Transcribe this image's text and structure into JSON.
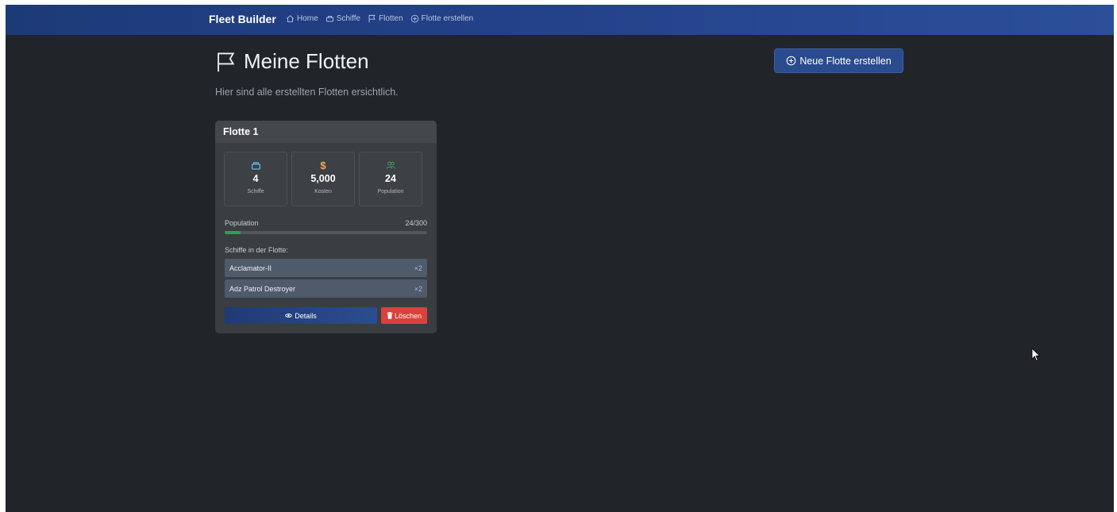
{
  "navbar": {
    "brand": "Fleet Builder",
    "links": [
      {
        "label": "Home",
        "icon": "house-icon"
      },
      {
        "label": "Schiffe",
        "icon": "ship-icon"
      },
      {
        "label": "Flotten",
        "icon": "flag-icon"
      },
      {
        "label": "Flotte erstellen",
        "icon": "plus-circle-icon"
      }
    ]
  },
  "header": {
    "title": "Meine Flotten",
    "subtitle": "Hier sind alle erstellten Flotten ersichtlich.",
    "new_button": "Neue Flotte erstellen"
  },
  "fleet": {
    "name": "Flotte 1",
    "stats": [
      {
        "value": "4",
        "label": "Schiffe",
        "icon": "ship-icon",
        "color": "#5bc0de"
      },
      {
        "value": "5,000",
        "label": "Kosten",
        "icon": "dollar-icon",
        "symbol": "$",
        "color": "#f0ad4e"
      },
      {
        "value": "24",
        "label": "Population",
        "icon": "people-icon",
        "color": "#3fa35f"
      }
    ],
    "population_label": "Population",
    "population_text": "24/300",
    "population_fraction": 0.08,
    "ships_label": "Schiffe in der Flotte:",
    "ships": [
      {
        "name": "Acclamator-II",
        "count": "×2"
      },
      {
        "name": "Adz Patrol Destroyer",
        "count": "×2"
      }
    ],
    "details_button": "Details",
    "delete_button": "Löschen"
  },
  "colors": {
    "background": "#212529",
    "navbar": "#24428a",
    "primary": "#2a4b8d",
    "danger": "#d9413a",
    "success": "#2e9e55"
  }
}
